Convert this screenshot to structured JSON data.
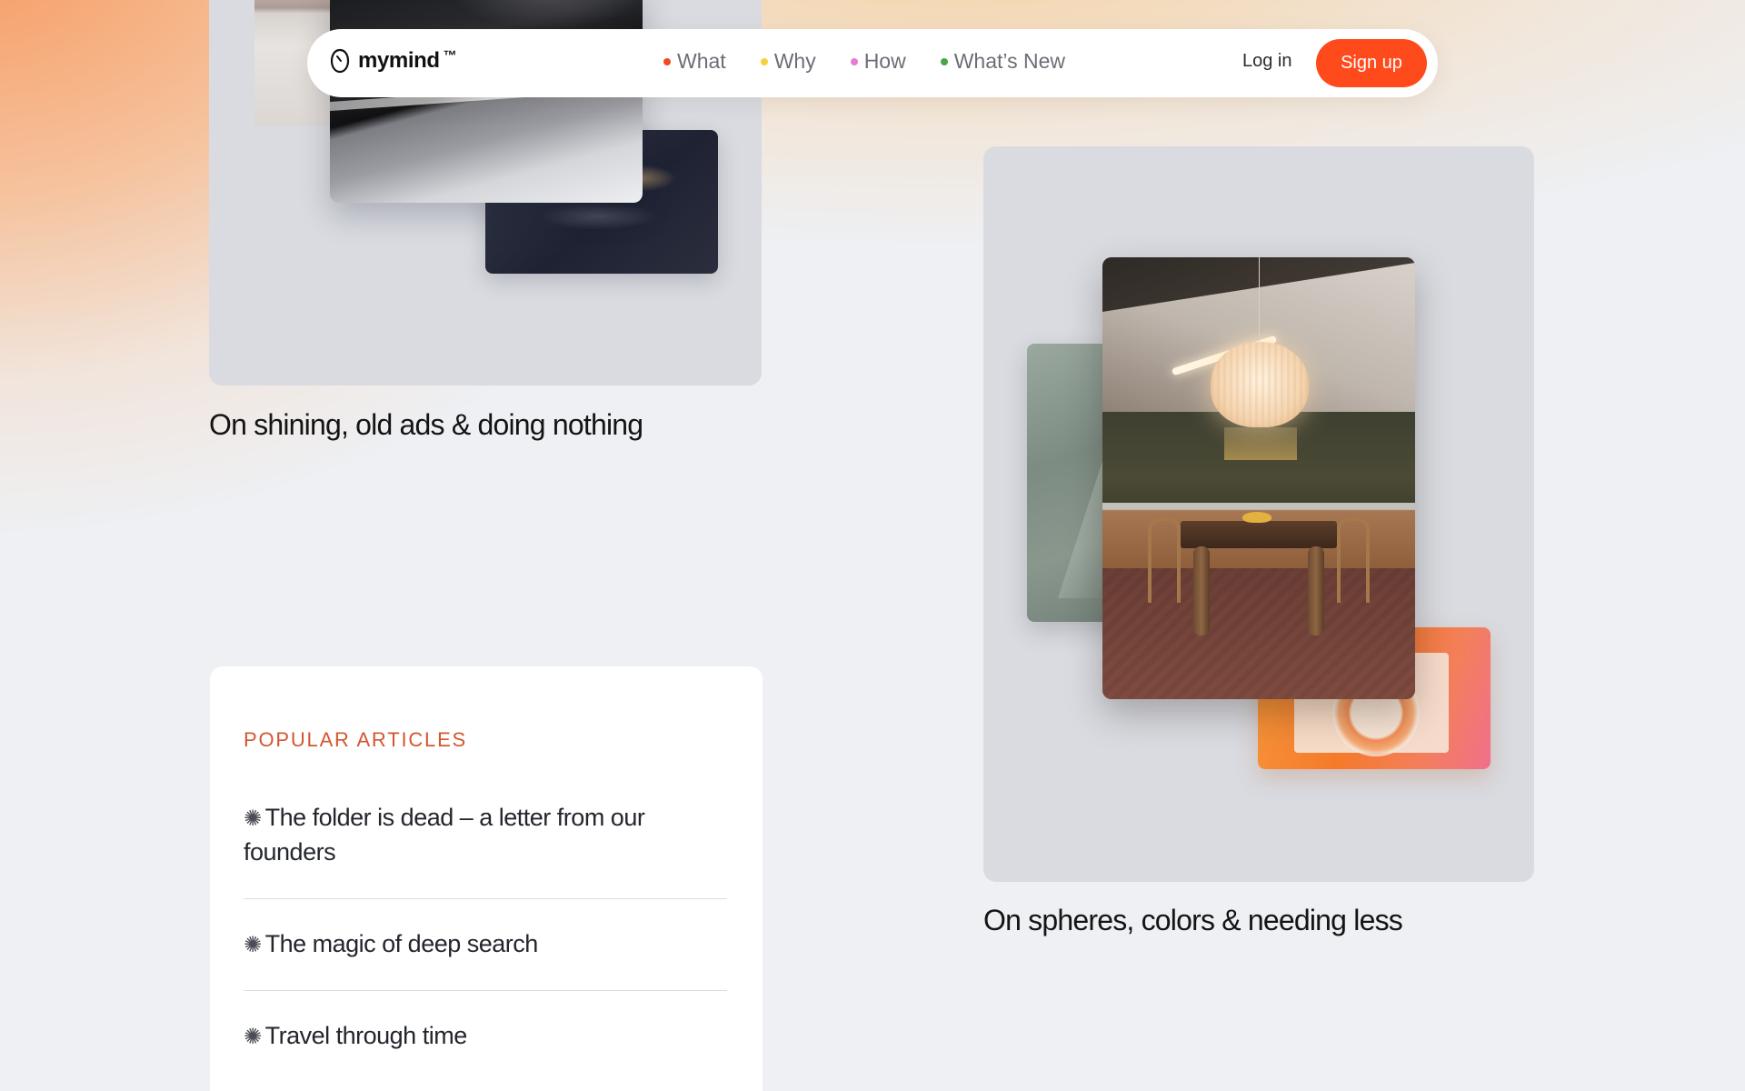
{
  "nav": {
    "brand": "mymind",
    "trademark": "™",
    "links": [
      {
        "label": "What",
        "dot_color": "#f04a23"
      },
      {
        "label": "Why",
        "dot_color": "#f4d23d"
      },
      {
        "label": "How",
        "dot_color": "#e77ad2"
      },
      {
        "label": "What’s New",
        "dot_color": "#4aa644"
      }
    ],
    "login_label": "Log in",
    "signup_label": "Sign up"
  },
  "articles_feed": {
    "top_caption": "On shining, old ads & doing nothing",
    "right_caption": "On spheres, colors & needing less"
  },
  "popular": {
    "title": "POPULAR ARTICLES",
    "bullet": "✺",
    "items": [
      "The folder is dead – a letter from our founders",
      "The magic of deep search",
      "Travel through time"
    ]
  },
  "colors": {
    "accent": "#ff4a1c",
    "popular_title": "#d4562f",
    "card_bg": "#d9dbe1"
  }
}
